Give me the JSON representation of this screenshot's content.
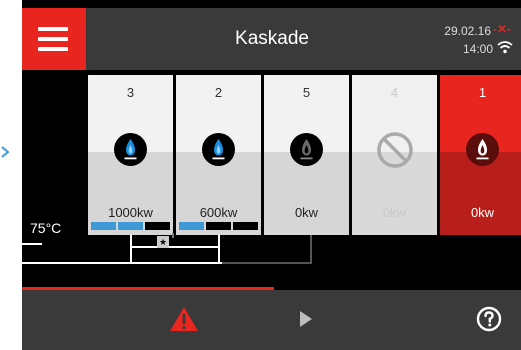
{
  "header": {
    "title": "Kaskade",
    "date": "29.02.16",
    "time": "14:00"
  },
  "boilers": [
    {
      "number": "3",
      "power": "1000kw",
      "state": "active",
      "flame_color": "#1a8fe0",
      "load_segments": [
        "#3d9ad6",
        "#3d9ad6",
        "#000000"
      ]
    },
    {
      "number": "2",
      "power": "600kw",
      "state": "active",
      "flame_color": "#1a8fe0",
      "load_segments": [
        "#3d9ad6",
        "#000000",
        "#000000"
      ]
    },
    {
      "number": "5",
      "power": "0kw",
      "state": "idle",
      "flame_color": "#888888"
    },
    {
      "number": "4",
      "power": "0kw",
      "state": "disabled"
    },
    {
      "number": "1",
      "power": "0kw",
      "state": "alarm",
      "flame_color": "#ffffff"
    }
  ],
  "system": {
    "temperature": "75°C",
    "lead_marker": "★"
  },
  "colors": {
    "accent": "#e8251f",
    "header_bg": "#3a3a3a",
    "load_blue": "#3d9ad6"
  },
  "icons": {
    "menu": "hamburger-icon",
    "alarm": "warning-triangle-icon",
    "next": "play-icon",
    "help": "help-icon",
    "wifi": "wifi-icon",
    "error": "x-icon"
  }
}
